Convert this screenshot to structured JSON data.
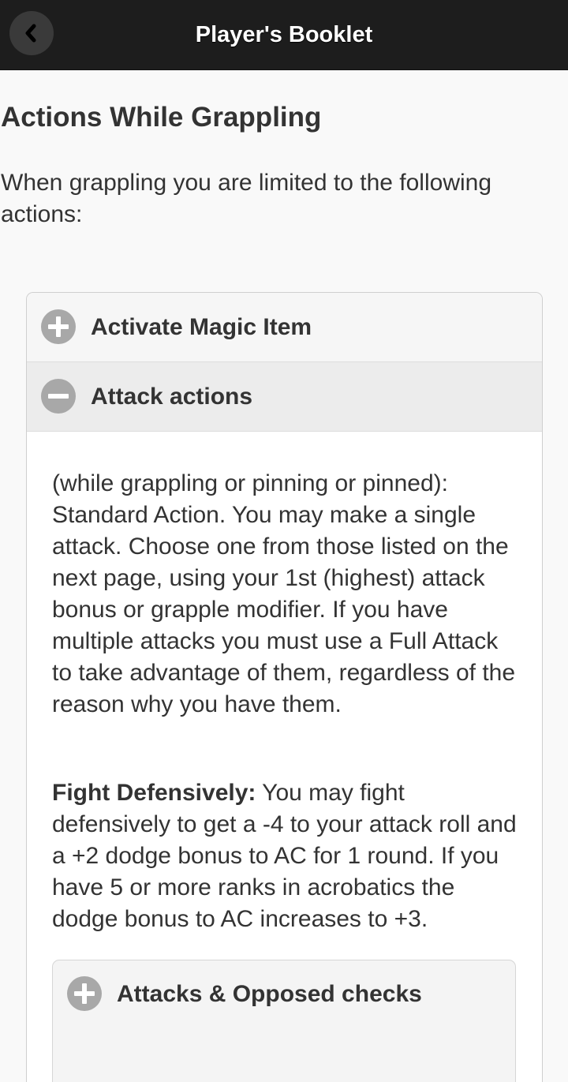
{
  "header": {
    "title": "Player's Booklet",
    "back_icon": "chevron-left-icon"
  },
  "page": {
    "title": "Actions While Grappling",
    "intro": "When grappling you are limited to the following actions:"
  },
  "accordion": {
    "items": [
      {
        "label": "Activate Magic Item",
        "state": "collapsed",
        "icon": "plus-icon"
      },
      {
        "label": "Attack actions",
        "state": "expanded",
        "icon": "minus-icon",
        "paragraph_1": "(while grappling or pinning or pinned): Standard Action. You may make a single attack. Choose one from those listed on the next page, using your 1st (highest) attack bonus or grapple modifier. If you have multiple attacks you must use a Full Attack to take advantage of them, regardless of the reason why you have them.",
        "paragraph_2_bold": "Fight Defensively:",
        "paragraph_2_text": " You may fight defensively to get a -4 to your attack roll and a +2 dodge bonus to AC for 1 round. If you have 5 or more ranks in acrobatics the dodge bonus to AC increases to +3.",
        "nested_items": [
          {
            "label": "Attacks & Opposed checks",
            "state": "collapsed",
            "icon": "plus-icon"
          }
        ]
      }
    ]
  },
  "colors": {
    "topbar": "#1d1d1d",
    "background": "#f9f9f9",
    "text": "#333333",
    "icon_bg": "#a8a8a8"
  }
}
